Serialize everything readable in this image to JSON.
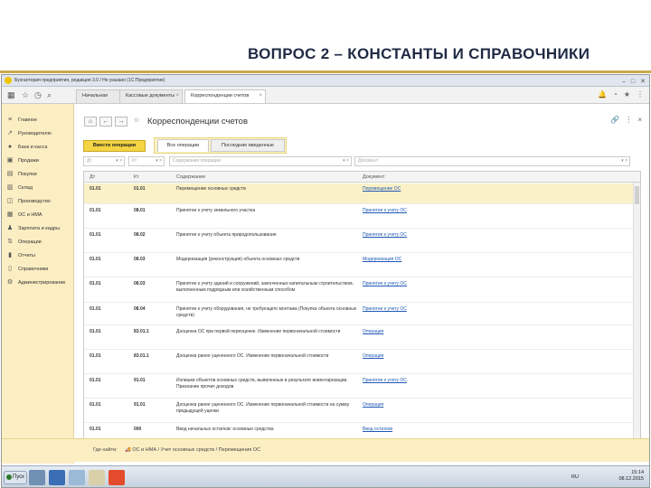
{
  "slide": {
    "title": "ВОПРОС 2 – КОНСТАНТЫ И СПРАВОЧНИКИ"
  },
  "window": {
    "title": "Бухгалтерия предприятия, редакция 3.0 / Не указано  (1С:Предприятие)"
  },
  "tabs": [
    {
      "label": "Начальная страница"
    },
    {
      "label": "Кассовые документы"
    },
    {
      "label": "Корреспонденции счетов"
    }
  ],
  "sidebar": {
    "items": [
      {
        "label": "Главное",
        "icon": "menu-icon"
      },
      {
        "label": "Руководителю",
        "icon": "chart-icon"
      },
      {
        "label": "Банк и касса",
        "icon": "bank-icon"
      },
      {
        "label": "Продажи",
        "icon": "sales-icon"
      },
      {
        "label": "Покупки",
        "icon": "purchases-icon"
      },
      {
        "label": "Склад",
        "icon": "warehouse-icon"
      },
      {
        "label": "Производство",
        "icon": "production-icon"
      },
      {
        "label": "ОС и НМА",
        "icon": "assets-icon"
      },
      {
        "label": "Зарплата и кадры",
        "icon": "staff-icon"
      },
      {
        "label": "Операции",
        "icon": "operations-icon"
      },
      {
        "label": "Отчеты",
        "icon": "reports-icon"
      },
      {
        "label": "Справочники",
        "icon": "catalogs-icon"
      },
      {
        "label": "Администрирование",
        "icon": "admin-icon"
      }
    ]
  },
  "form": {
    "title": "Корреспонденции счетов",
    "main_button": "Ввести операции",
    "filter_tabs": [
      {
        "label": "Все операции"
      },
      {
        "label": "Последние введенные"
      }
    ],
    "filters": {
      "dt": "Дт",
      "kt": "Кт",
      "content_placeholder": "Содержание операции",
      "doc_placeholder": "Документ"
    },
    "columns": {
      "dt": "Дт",
      "kt": "Кт",
      "content": "Содержание",
      "doc": "Документ"
    },
    "rows": [
      {
        "dt": "01.01",
        "kt": "01.01",
        "content": "Перемещение основных средств",
        "doc": "Перемещение ОС"
      },
      {
        "dt": "01.01",
        "kt": "08.01",
        "content": "Принятие к учету земельного участка",
        "doc": "Принятие к учету ОС"
      },
      {
        "dt": "01.01",
        "kt": "08.02",
        "content": "Принятие к учету объекта природопользования",
        "doc": "Принятие к учету ОС"
      },
      {
        "dt": "01.01",
        "kt": "08.03",
        "content": "Модернизация (реконструкция) объекта основных средств",
        "doc": "Модернизация ОС"
      },
      {
        "dt": "01.01",
        "kt": "08.03",
        "content": "Принятие к учету зданий и сооружений, законченных капитальным строительством, выполненным подрядным или хозяйственным способом",
        "doc": "Принятие к учету ОС"
      },
      {
        "dt": "01.01",
        "kt": "08.04",
        "content": "Принятие к учету оборудования, не требующего монтажа (Покупка объекта основных средств)",
        "doc": "Принятие к учету ОС"
      },
      {
        "dt": "01.01",
        "kt": "83.01.1",
        "content": "Дооценка ОС при первой переоценке. Изменение первоначальной стоимости",
        "doc": "Операция"
      },
      {
        "dt": "01.01",
        "kt": "83.01.1",
        "content": "Дооценка ранее уцененного ОС. Изменение первоначальной стоимости",
        "doc": "Операция"
      },
      {
        "dt": "01.01",
        "kt": "91.01",
        "content": "Излишки объектов основных средств, выявленные в результате инвентаризации. Признание прочих доходов",
        "doc": "Принятие к учету ОС"
      },
      {
        "dt": "01.01",
        "kt": "91.01",
        "content": "Дооценка ранее уцененного ОС. Изменение первоначальной стоимости на сумму предыдущей уценки",
        "doc": "Операция"
      },
      {
        "dt": "01.01",
        "kt": "000",
        "content": "Ввод начальных остатков: основные средства",
        "doc": "Ввод остатков"
      }
    ]
  },
  "footer": {
    "where_label": "Где найти:",
    "path": "ОС и НМА / Учет основных средств / Перемещения ОС"
  },
  "taskbar": {
    "start": "Пуск",
    "lang": "RU",
    "time": "15:14",
    "date": "08.12.2015"
  }
}
